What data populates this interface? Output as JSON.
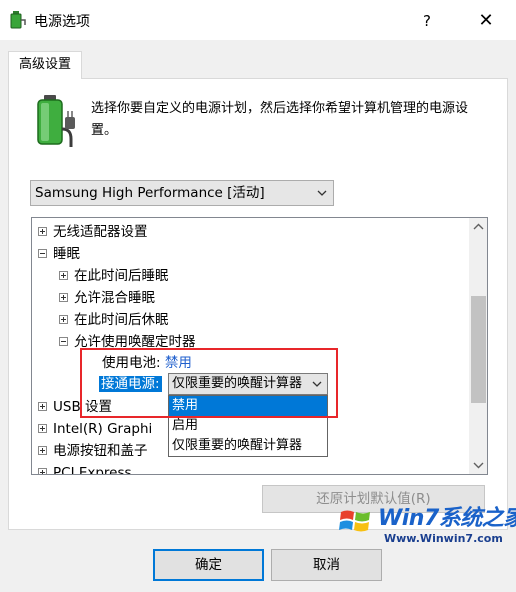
{
  "window": {
    "title": "电源选项",
    "help": "?",
    "close": "✕"
  },
  "tab": {
    "label": "高级设置"
  },
  "description": "选择你要自定义的电源计划，然后选择你希望计算机管理的电源设置。",
  "plan_select": {
    "value": "Samsung High Performance [活动]"
  },
  "tree": {
    "items": [
      {
        "label": "无线适配器设置",
        "expander": "plus"
      },
      {
        "label": "睡眠",
        "expander": "minus"
      },
      {
        "label": "在此时间后睡眠",
        "expander": "plus"
      },
      {
        "label": "允许混合睡眠",
        "expander": "plus"
      },
      {
        "label": "在此时间后休眠",
        "expander": "plus"
      },
      {
        "label": "允许使用唤醒定时器",
        "expander": "minus"
      },
      {
        "label": "USB 设置",
        "expander": "plus"
      },
      {
        "label": "Intel(R) Graphi",
        "expander": "plus"
      },
      {
        "label": "电源按钮和盖子",
        "expander": "plus"
      },
      {
        "label": "PCI Express",
        "expander": "plus"
      }
    ],
    "battery": {
      "label": "使用电池:",
      "value": "禁用"
    },
    "ac": {
      "label": "接通电源:",
      "value": "仅限重要的唤醒计算器"
    }
  },
  "dropdown": {
    "options": [
      "禁用",
      "启用",
      "仅限重要的唤醒计算器"
    ],
    "highlighted_index": 0
  },
  "buttons": {
    "restore": "还原计划默认值(R)",
    "ok": "确定",
    "cancel": "取消"
  },
  "watermark": {
    "brand": "Win7系统之家",
    "url": "Www.Winwin7.com"
  },
  "colors": {
    "accent": "#0078d7",
    "highlight_box": "#e8262a",
    "link": "#1f5fcd"
  }
}
